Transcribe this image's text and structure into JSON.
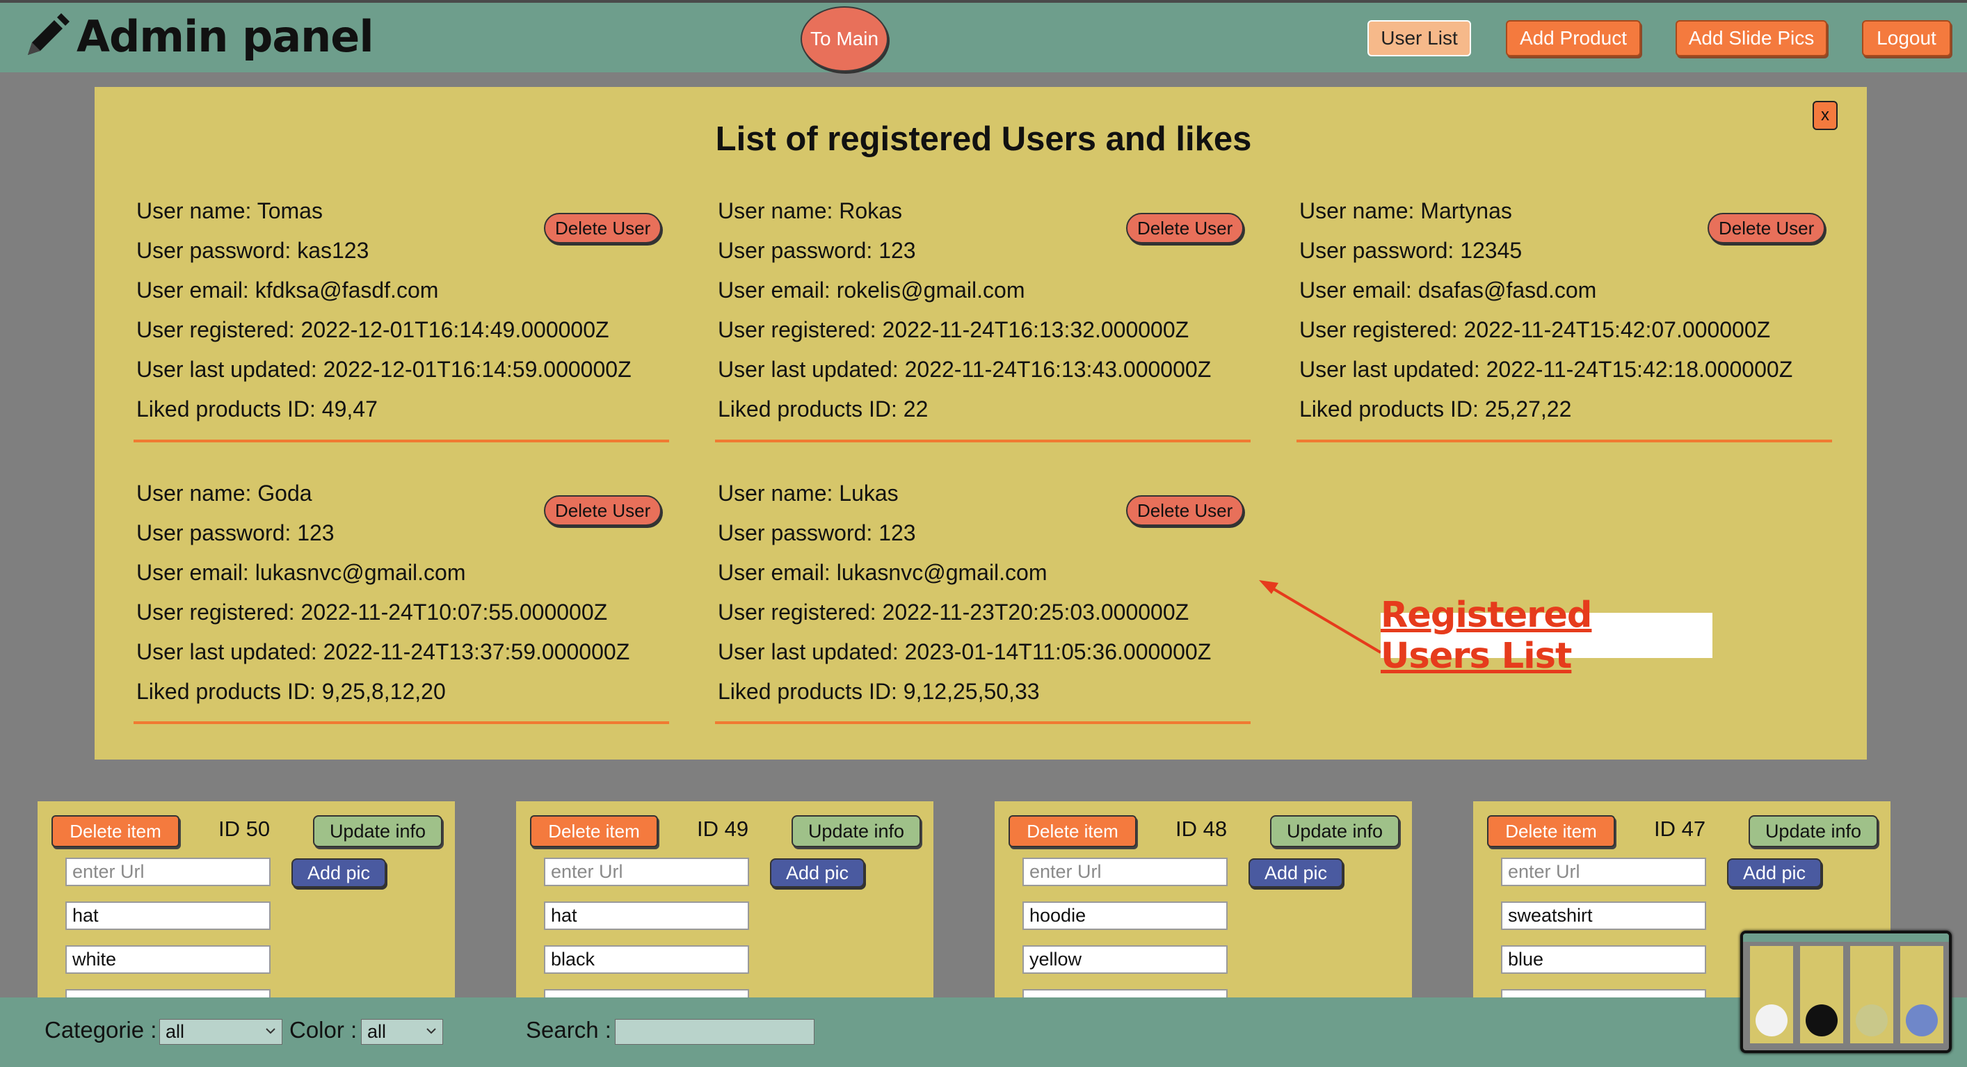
{
  "header": {
    "title": "Admin panel",
    "to_main": "To Main",
    "nav": [
      "User List",
      "Add Product",
      "Add Slide Pics",
      "Logout"
    ]
  },
  "modal": {
    "title": "List of registered Users and likes",
    "close_label": "x",
    "delete_label": "Delete User",
    "users": [
      {
        "name": "User name: Tomas",
        "password": "User password: kas123",
        "email": "User email: kfdksa@fasdf.com",
        "registered": "User registered: 2022-12-01T16:14:49.000000Z",
        "updated": "User last updated: 2022-12-01T16:14:59.000000Z",
        "liked": "Liked products ID: 49,47"
      },
      {
        "name": "User name: Rokas",
        "password": "User password: 123",
        "email": "User email: rokelis@gmail.com",
        "registered": "User registered: 2022-11-24T16:13:32.000000Z",
        "updated": "User last updated: 2022-11-24T16:13:43.000000Z",
        "liked": "Liked products ID: 22"
      },
      {
        "name": "User name: Martynas",
        "password": "User password: 12345",
        "email": "User email: dsafas@fasd.com",
        "registered": "User registered: 2022-11-24T15:42:07.000000Z",
        "updated": "User last updated: 2022-11-24T15:42:18.000000Z",
        "liked": "Liked products ID: 25,27,22"
      },
      {
        "name": "User name: Goda",
        "password": "User password: 123",
        "email": "User email: lukasnvc@gmail.com",
        "registered": "User registered: 2022-11-24T10:07:55.000000Z",
        "updated": "User last updated: 2022-11-24T13:37:59.000000Z",
        "liked": "Liked products ID: 9,25,8,12,20"
      },
      {
        "name": "User name: Lukas",
        "password": "User password: 123",
        "email": "User email: lukasnvc@gmail.com",
        "registered": "User registered: 2022-11-23T20:25:03.000000Z",
        "updated": "User last updated: 2023-01-14T11:05:36.000000Z",
        "liked": "Liked products ID: 9,12,25,50,33"
      }
    ],
    "annotation": "Registered Users List"
  },
  "products": {
    "delete_label": "Delete item",
    "update_label": "Update info",
    "add_pic_label": "Add pic",
    "url_placeholder": "enter Url",
    "items": [
      {
        "id": "ID 50",
        "name": "hat",
        "color": "white"
      },
      {
        "id": "ID 49",
        "name": "hat",
        "color": "black"
      },
      {
        "id": "ID 48",
        "name": "hoodie",
        "color": "yellow"
      },
      {
        "id": "ID 47",
        "name": "sweatshirt",
        "color": "blue"
      }
    ]
  },
  "filters": {
    "category_label": "Categorie :",
    "category_value": "all",
    "color_label": "Color :",
    "color_value": "all",
    "search_label": "Search :"
  },
  "colors": {
    "header_bg": "#6e9e8c",
    "panel_bg": "#d6c66a",
    "accent_orange": "#f47a3e",
    "delete_red": "#e8705a",
    "add_pic_blue": "#4a5aa0",
    "update_green": "#9fc189",
    "annotation_red": "#e63b1c"
  }
}
